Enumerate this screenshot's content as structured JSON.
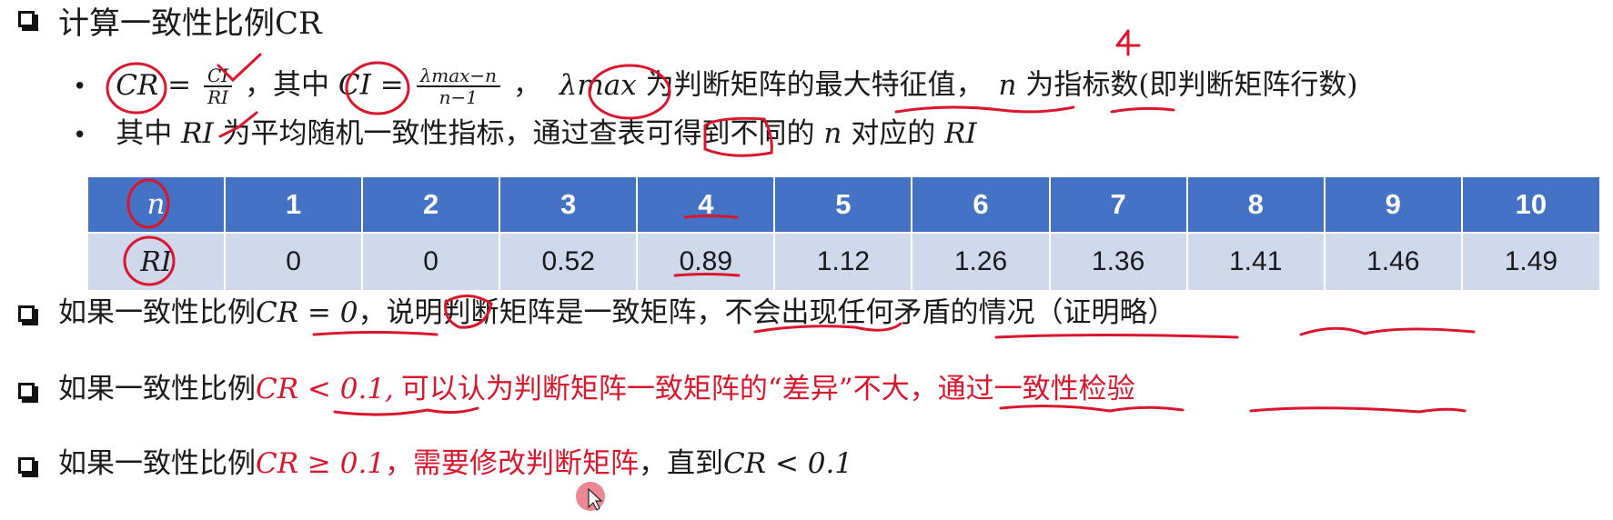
{
  "heading": {
    "text": "计算一致性比例CR"
  },
  "bullets": [
    {
      "cr": "CR",
      "eq": "=",
      "ci_num": "CI",
      "ri_den": "RI",
      "text1": "，其中",
      "ci": "CI",
      "eq2": "=",
      "lambda_num": "λmax−n",
      "n_den": "n−1",
      "comma": "，",
      "lambda": "λmax",
      "text2": "为判断矩阵的最大特征值，",
      "n": "n",
      "text3": "为指标数(即判断矩阵行数)"
    },
    {
      "text1": "其中",
      "ri": "RI",
      "text2": "为平均随机一致性指标，通过查表可得到不同的",
      "n": "n",
      "text3": "对应的",
      "ri2": "RI"
    }
  ],
  "table": {
    "row_headers": [
      "n",
      "RI"
    ],
    "columns": [
      "1",
      "2",
      "3",
      "4",
      "5",
      "6",
      "7",
      "8",
      "9",
      "10"
    ],
    "ri_values": [
      "0",
      "0",
      "0.52",
      "0.89",
      "1.12",
      "1.26",
      "1.36",
      "1.41",
      "1.46",
      "1.49"
    ]
  },
  "rules": [
    {
      "prefix": "如果一致性比例",
      "math": "CR = 0",
      "rest": "，说明判断矩阵是一致矩阵，不会出现任何矛盾的情况（证明略）"
    },
    {
      "prefix": "如果一致性比例",
      "math": "CR < 0.1,",
      "rest": "可以认为判断矩阵一致矩阵的“差异”不大，通过一致性检验"
    },
    {
      "prefix": "如果一致性比例",
      "math": "CR ≥ 0.1",
      "rest_red": "，需要修改判断矩阵",
      "rest": "，直到",
      "math2": "CR < 0.1"
    }
  ],
  "annotations": {
    "handwritten_four": "4"
  },
  "colors": {
    "table_header": "#4472c4",
    "table_row": "#d0d8eb",
    "highlight": "#d9162c"
  }
}
